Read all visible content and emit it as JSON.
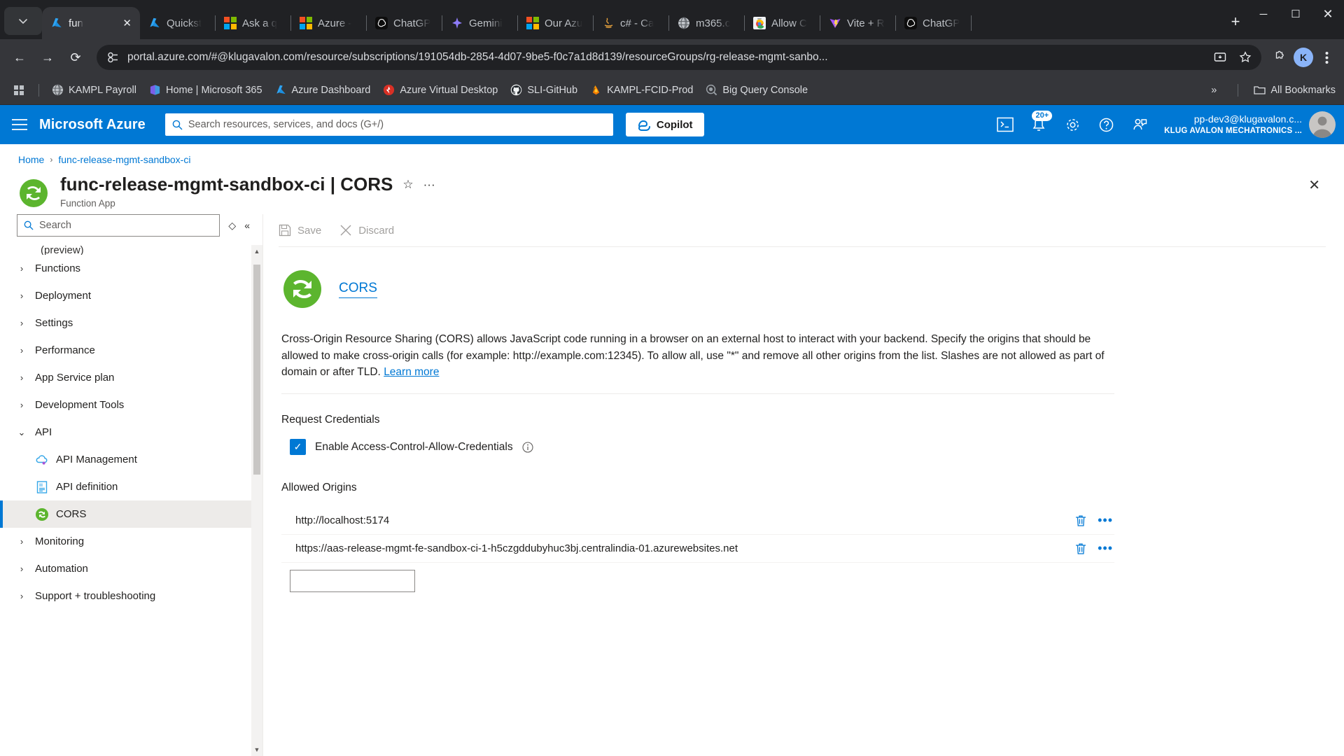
{
  "browser": {
    "tabs": [
      {
        "title": "fun",
        "favicon": "azure-icon",
        "active": true
      },
      {
        "title": "Quickst",
        "favicon": "azure-icon",
        "active": false
      },
      {
        "title": "Ask a q",
        "favicon": "microsoft-icon",
        "active": false
      },
      {
        "title": "Azure -",
        "favicon": "microsoft-icon",
        "active": false
      },
      {
        "title": "ChatGP",
        "favicon": "openai-icon",
        "active": false
      },
      {
        "title": "Gemini",
        "favicon": "gemini-icon",
        "active": false
      },
      {
        "title": "Our Azu",
        "favicon": "microsoft-icon",
        "active": false
      },
      {
        "title": "c# - Ca",
        "favicon": "java-icon",
        "active": false
      },
      {
        "title": "m365.c",
        "favicon": "globe-icon",
        "active": false
      },
      {
        "title": "Allow C",
        "favicon": "chrome-icon",
        "active": false
      },
      {
        "title": "Vite + R",
        "favicon": "vite-icon",
        "active": false
      },
      {
        "title": "ChatGP",
        "favicon": "openai-icon",
        "active": false
      }
    ],
    "new_tab_label": "+",
    "window_controls": {
      "minimize": "─",
      "maximize": "☐",
      "close": "✕"
    },
    "nav": {
      "back": "←",
      "forward": "→",
      "reload": "⟳"
    },
    "url": "portal.azure.com/#@klugavalon.com/resource/subscriptions/191054db-2854-4d07-9be5-f0c7a1d8d139/resourceGroups/rg-release-mgmt-sanbo...",
    "profile_initial": "K",
    "bookmarks": [
      {
        "label": "KAMPL Payroll",
        "icon": "globe-icon"
      },
      {
        "label": "Home | Microsoft 365",
        "icon": "m365-icon"
      },
      {
        "label": "Azure Dashboard",
        "icon": "azure-icon"
      },
      {
        "label": "Azure Virtual Desktop",
        "icon": "avd-icon"
      },
      {
        "label": "SLI-GitHub",
        "icon": "github-icon"
      },
      {
        "label": "KAMPL-FCID-Prod",
        "icon": "firebase-icon"
      },
      {
        "label": "Big Query Console",
        "icon": "bigquery-icon"
      }
    ],
    "bookmarks_overflow": "»",
    "all_bookmarks_label": "All Bookmarks"
  },
  "azure": {
    "brand": "Microsoft Azure",
    "search_placeholder": "Search resources, services, and docs (G+/)",
    "copilot_label": "Copilot",
    "notification_badge": "20+",
    "user_email": "pp-dev3@klugavalon.c...",
    "user_org": "KLUG AVALON MECHATRONICS ...",
    "breadcrumb": {
      "home": "Home",
      "separator": "›",
      "current": "func-release-mgmt-sandbox-ci"
    },
    "page": {
      "title": "func-release-mgmt-sandbox-ci | CORS",
      "subtitle": "Function App",
      "star": "☆",
      "more": "···",
      "close": "✕"
    }
  },
  "sidebar": {
    "search_placeholder": "Search",
    "sort_icon": "◇",
    "collapse_icon": "«",
    "partial_item": "(preview)",
    "items": [
      {
        "label": "Functions",
        "type": "group",
        "chevron": "›"
      },
      {
        "label": "Deployment",
        "type": "group",
        "chevron": "›"
      },
      {
        "label": "Settings",
        "type": "group",
        "chevron": "›"
      },
      {
        "label": "Performance",
        "type": "group",
        "chevron": "›"
      },
      {
        "label": "App Service plan",
        "type": "group",
        "chevron": "›"
      },
      {
        "label": "Development Tools",
        "type": "group",
        "chevron": "›"
      },
      {
        "label": "API",
        "type": "group",
        "chevron": "⌄",
        "expanded": true
      },
      {
        "label": "API Management",
        "type": "child",
        "icon": "api-management-icon"
      },
      {
        "label": "API definition",
        "type": "child",
        "icon": "api-definition-icon"
      },
      {
        "label": "CORS",
        "type": "child",
        "icon": "cors-icon",
        "selected": true
      },
      {
        "label": "Monitoring",
        "type": "group",
        "chevron": "›"
      },
      {
        "label": "Automation",
        "type": "group",
        "chevron": "›"
      },
      {
        "label": "Support + troubleshooting",
        "type": "group",
        "chevron": "›"
      }
    ]
  },
  "toolbar": {
    "save_label": "Save",
    "discard_label": "Discard"
  },
  "cors": {
    "heading": "CORS",
    "description": "Cross-Origin Resource Sharing (CORS) allows JavaScript code running in a browser on an external host to interact with your backend. Specify the origins that should be allowed to make cross-origin calls (for example: http://example.com:12345). To allow all, use \"*\" and remove all other origins from the list. Slashes are not allowed as part of domain or after TLD.",
    "learn_more": "Learn more",
    "request_credentials_title": "Request Credentials",
    "enable_credentials_label": "Enable Access-Control-Allow-Credentials",
    "enable_credentials_checked": true,
    "checkmark": "✓",
    "allowed_origins_title": "Allowed Origins",
    "origins": [
      {
        "url": "http://localhost:5174",
        "delete_icon": "trash-icon",
        "menu": "•••"
      },
      {
        "url": "https://aas-release-mgmt-fe-sandbox-ci-1-h5czgddubyhuc3bj.centralindia-01.azurewebsites.net",
        "delete_icon": "trash-icon",
        "menu": "•••"
      }
    ],
    "new_origin_value": "",
    "new_origin_placeholder": ""
  },
  "colors": {
    "azure_blue": "#0078d4",
    "chrome_dark": "#202124",
    "chrome_tabstrip": "#35363a",
    "selected_row": "#edebe9",
    "link": "#0078d4"
  }
}
